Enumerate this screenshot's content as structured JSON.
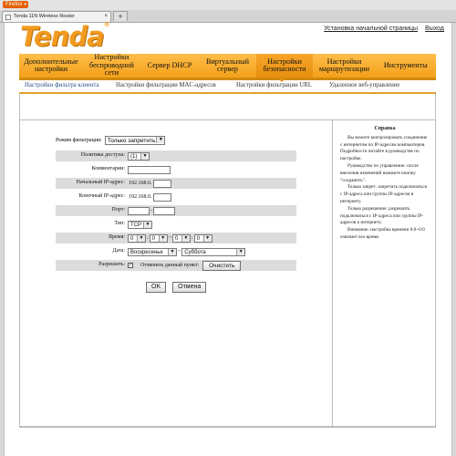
{
  "browser": {
    "app_button": "Firefox",
    "tab_title": "Tenda 11N Wireless Router",
    "newtab": "+"
  },
  "toplinks": {
    "setup": "Установка начальной страницы",
    "exit": "Выход"
  },
  "logo": {
    "text": "Tenda",
    "reg": "®"
  },
  "nav": [
    "Дополнительные настройки",
    "Настройки беспроводной сети",
    "Сервер DHCP",
    "Виртуальный сервер",
    "Настройки безопасности",
    "Настройки маршрутизации",
    "Инструменты"
  ],
  "nav_active_index": 4,
  "subnav": [
    "Настройки фильтра клиента",
    "Настройки фильтрации MAC-адресов",
    "Настройки фильтрации URL",
    "Удаленное веб-управление"
  ],
  "form": {
    "mode_label": "Режим фильтрации:",
    "mode_value": "Только запретить",
    "policy_label": "Политика доступа:",
    "policy_value": "(1)",
    "comment_label": "Комментарии:",
    "comment_value": "",
    "start_ip_label": "Начальный IP-адрес:",
    "start_ip_prefix": "192.168.0.",
    "end_ip_label": "Конечный IP-адрес:",
    "end_ip_prefix": "192.168.0.",
    "port_label": "Порт:",
    "port_sep": "-",
    "type_label": "Тип:",
    "type_value": "TCP",
    "time_label": "Время:",
    "time_h1": "0",
    "time_m1": "0",
    "time_sep": "~",
    "time_h2": "0",
    "time_m2": "0",
    "time_colon": ":",
    "day_label": "Дата:",
    "day_from": "Воскресенье",
    "day_sep": "~",
    "day_to": "Суббота",
    "enable_label": "Разрешить:",
    "enable_check": "✓",
    "clear_label": "Отменить данный пункт:",
    "clear_button": "Очистить",
    "ok_button": "OK",
    "cancel_button": "Отмена"
  },
  "help": {
    "title": "Справка",
    "p1": "Вы можете контролировать соединение с интернетом по IP-адресам компьютеров. Подробности читайте в руководстве по настройке.",
    "p2": "Руководство по управлению: после внесения изменений нажмите кнопку \"сохранить\".",
    "p3": "Только запрет: запретить подключаться с IP-адреса или группы IP-адресов в интернету.",
    "p4": "Только разрешение: разрешить подключаться с IP-адреса или группы IP-адресов к интернету.",
    "p5": "Внимание: настройка времени 0:0~0:0 означает все время."
  }
}
